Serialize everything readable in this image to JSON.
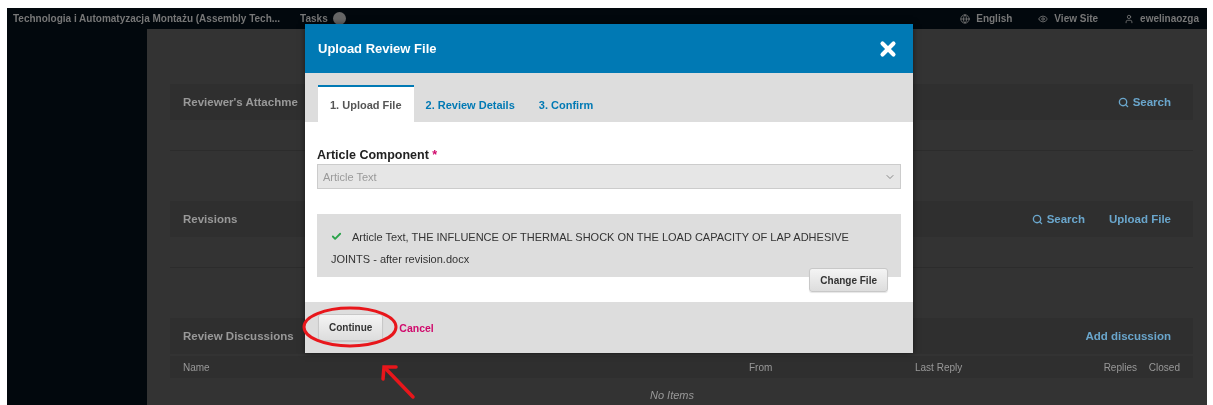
{
  "top_bar": {
    "site_title": "Technologia i Automatyzacja Montażu (Assembly Tech...",
    "tasks_label": "Tasks",
    "language": "English",
    "view_site": "View Site",
    "user": "ewelinaozga"
  },
  "sections": [
    {
      "title": "Reviewer's Attachme",
      "actions": [
        {
          "label": "Search",
          "kind": "search"
        }
      ]
    },
    {
      "title": "Revisions",
      "actions": [
        {
          "label": "Search",
          "kind": "search"
        },
        {
          "label": "Upload File",
          "kind": "plain"
        }
      ]
    },
    {
      "title": "Review Discussions",
      "actions": [
        {
          "label": "Add discussion",
          "kind": "plain"
        }
      ],
      "columns": [
        "Name",
        "From",
        "Last Reply",
        "Replies",
        "Closed"
      ],
      "empty_message": "No Items"
    }
  ],
  "modal": {
    "title": "Upload Review File",
    "tabs": [
      {
        "label": "1. Upload File",
        "selected": true
      },
      {
        "label": "2. Review Details",
        "selected": false
      },
      {
        "label": "3. Confirm",
        "selected": false
      }
    ],
    "field_label": "Article Component",
    "required_mark": "*",
    "select_value": "Article Text",
    "uploaded_file": "Article Text, THE INFLUENCE OF THERMAL SHOCK ON THE LOAD CAPACITY OF LAP ADHESIVE JOINTS - after revision.docx",
    "change_file_button": "Change File",
    "continue_button": "Continue",
    "cancel_link": "Cancel"
  }
}
